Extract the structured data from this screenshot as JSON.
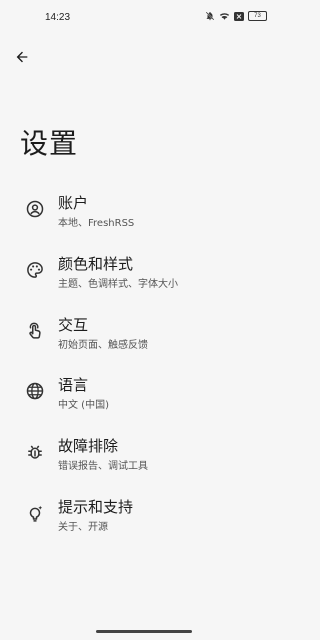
{
  "status_bar": {
    "time": "14:23",
    "battery": "73",
    "icons": [
      "mute-icon",
      "wifi-icon",
      "notification-icon",
      "battery-icon"
    ]
  },
  "header": {
    "back_icon": "arrow-left-icon",
    "title": "设置"
  },
  "settings": {
    "items": [
      {
        "icon": "account-circle-icon",
        "title": "账户",
        "subtitle": "本地、FreshRSS"
      },
      {
        "icon": "palette-icon",
        "title": "颜色和样式",
        "subtitle": "主题、色调样式、字体大小"
      },
      {
        "icon": "touch-icon",
        "title": "交互",
        "subtitle": "初始页面、触感反馈"
      },
      {
        "icon": "globe-icon",
        "title": "语言",
        "subtitle": "中文 (中国)"
      },
      {
        "icon": "bug-icon",
        "title": "故障排除",
        "subtitle": "错误报告、调试工具"
      },
      {
        "icon": "lightbulb-icon",
        "title": "提示和支持",
        "subtitle": "关于、开源"
      }
    ]
  }
}
